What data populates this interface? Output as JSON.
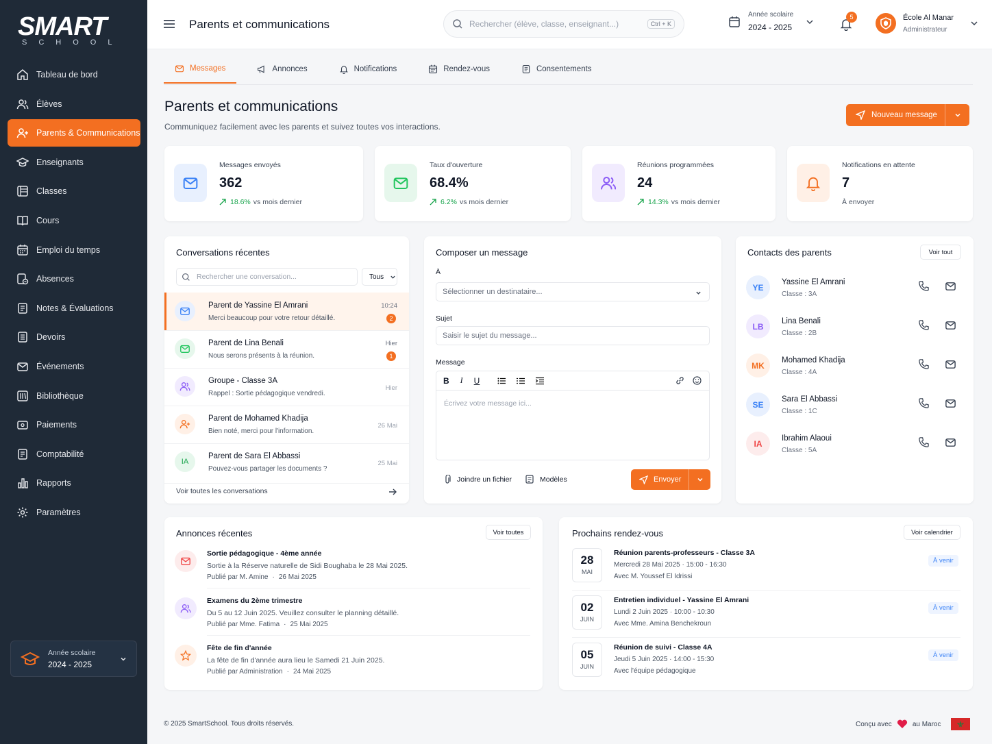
{
  "brand": {
    "name": "SMART",
    "sub": "SCHOOL"
  },
  "sidebar": {
    "items": [
      {
        "label": "Tableau de bord",
        "icon": "home-icon"
      },
      {
        "label": "Élèves",
        "icon": "users-icon"
      },
      {
        "label": "Parents & Communications",
        "icon": "user-group-icon"
      },
      {
        "label": "Enseignants",
        "icon": "graduation-cap-icon"
      },
      {
        "label": "Classes",
        "icon": "classes-icon"
      },
      {
        "label": "Cours",
        "icon": "book-icon"
      },
      {
        "label": "Emploi du temps",
        "icon": "calendar-icon"
      },
      {
        "label": "Absences",
        "icon": "absence-icon"
      },
      {
        "label": "Notes & Évaluations",
        "icon": "notes-icon"
      },
      {
        "label": "Devoirs",
        "icon": "homework-icon"
      },
      {
        "label": "Événements",
        "icon": "mail-icon"
      },
      {
        "label": "Bibliothèque",
        "icon": "library-icon"
      },
      {
        "label": "Paiements",
        "icon": "payment-icon"
      },
      {
        "label": "Comptabilité",
        "icon": "accounting-icon"
      },
      {
        "label": "Rapports",
        "icon": "chart-icon"
      },
      {
        "label": "Paramètres",
        "icon": "gear-icon"
      }
    ],
    "active_index": 2,
    "year_box": {
      "label": "Année scolaire",
      "value": "2024 - 2025"
    }
  },
  "topbar": {
    "title": "Parents et communications",
    "search_placeholder": "Rechercher (élève, classe, enseignant...)",
    "shortcut": "Ctrl + K",
    "year_label": "Année scolaire",
    "year_value": "2024 - 2025",
    "notif_count": "5",
    "school_name": "École Al Manar",
    "role": "Administrateur"
  },
  "tabs": [
    {
      "label": "Messages",
      "icon": "mail-icon"
    },
    {
      "label": "Annonces",
      "icon": "megaphone-icon"
    },
    {
      "label": "Notifications",
      "icon": "bell-icon"
    },
    {
      "label": "Rendez-vous",
      "icon": "calendar-icon"
    },
    {
      "label": "Consentements",
      "icon": "document-icon"
    }
  ],
  "page": {
    "title": "Parents et communications",
    "subtitle": "Communiquez facilement avec les parents et suivez toutes vos interactions.",
    "new_message": "Nouveau message"
  },
  "stats": [
    {
      "label": "Messages envoyés",
      "value": "362",
      "change": "18.6%",
      "vs": "vs mois dernier",
      "color": "#3b82f6"
    },
    {
      "label": "Taux d'ouverture",
      "value": "68.4%",
      "change": "6.2%",
      "vs": "vs mois dernier",
      "color": "#22c55e"
    },
    {
      "label": "Réunions programmées",
      "value": "24",
      "change": "14.3%",
      "vs": "vs mois dernier",
      "color": "#8b5cf6"
    },
    {
      "label": "Notifications en attente",
      "value": "7",
      "change": "",
      "vs": "À envoyer",
      "color": "#f36f21"
    }
  ],
  "conversations": {
    "title": "Conversations récentes",
    "search_placeholder": "Rechercher une conversation...",
    "filter": "Tous",
    "items": [
      {
        "name": "Parent de Yassine El Amrani",
        "message": "Merci beaucoup pour votre retour détaillé.",
        "time": "10:24",
        "unread": "2"
      },
      {
        "name": "Parent de Lina Benali",
        "message": "Nous serons présents à la réunion.",
        "time": "Hier",
        "unread": "1"
      },
      {
        "name": "Groupe - Classe 3A",
        "message": "Rappel : Sortie pédagogique vendredi.",
        "time": "Hier",
        "unread": ""
      },
      {
        "name": "Parent de Mohamed Khadija",
        "message": "Bien noté, merci pour l'information.",
        "time": "26 Mai",
        "unread": ""
      },
      {
        "name": "Parent de Sara El Abbassi",
        "message": "Pouvez-vous partager les documents ?",
        "time": "25 Mai",
        "unread": "",
        "initials": "IA"
      }
    ],
    "see_all": "Voir toutes les conversations"
  },
  "compose": {
    "title": "Composer un message",
    "to_label": "À",
    "to_placeholder": "Sélectionner un destinataire...",
    "subject_label": "Sujet",
    "subject_placeholder": "Saisir le sujet du message...",
    "message_label": "Message",
    "message_placeholder": "Écrivez votre message ici...",
    "attach": "Joindre un fichier",
    "templates": "Modèles",
    "send": "Envoyer"
  },
  "contacts": {
    "title": "Contacts des parents",
    "see_all": "Voir tout",
    "items": [
      {
        "initials": "YE",
        "name": "Yassine El Amrani",
        "class": "Classe : 3A",
        "color": "#3b82f6",
        "bg": "#e8f0fe"
      },
      {
        "initials": "LB",
        "name": "Lina Benali",
        "class": "Classe : 2B",
        "color": "#8b5cf6",
        "bg": "#f1ebfe"
      },
      {
        "initials": "MK",
        "name": "Mohamed Khadija",
        "class": "Classe : 4A",
        "color": "#f36f21",
        "bg": "#fff0e6"
      },
      {
        "initials": "SE",
        "name": "Sara El Abbassi",
        "class": "Classe : 1C",
        "color": "#3b82f6",
        "bg": "#e8f0fe"
      },
      {
        "initials": "IA",
        "name": "Ibrahim Alaoui",
        "class": "Classe : 5A",
        "color": "#ef4444",
        "bg": "#fdecec"
      }
    ]
  },
  "announcements": {
    "title": "Annonces récentes",
    "see_all": "Voir toutes",
    "items": [
      {
        "title": "Sortie pédagogique - 4ème année",
        "desc": "Sortie à la Réserve naturelle de Sidi Boughaba le 28 Mai 2025.",
        "author": "Publié par M. Amine",
        "date": "26 Mai 2025"
      },
      {
        "title": "Examens du 2ème trimestre",
        "desc": "Du 5 au 12 Juin 2025. Veuillez consulter le planning détaillé.",
        "author": "Publié par Mme. Fatima",
        "date": "25 Mai 2025"
      },
      {
        "title": "Fête de fin d'année",
        "desc": "La fête de fin d'année aura lieu le Samedi 21 Juin 2025.",
        "author": "Publié par Administration",
        "date": "24 Mai 2025"
      }
    ]
  },
  "appointments": {
    "title": "Prochains rendez-vous",
    "see_all": "Voir calendrier",
    "items": [
      {
        "day": "28",
        "month": "MAI",
        "title": "Réunion parents-professeurs - Classe 3A",
        "when": "Mercredi 28 Mai 2025 · 15:00 - 16:30",
        "with": "Avec M. Youssef El Idrissi",
        "status": "À venir"
      },
      {
        "day": "02",
        "month": "JUIN",
        "title": "Entretien individuel - Yassine El Amrani",
        "when": "Lundi 2 Juin 2025 · 10:00 - 10:30",
        "with": "Avec Mme. Amina Benchekroun",
        "status": "À venir"
      },
      {
        "day": "05",
        "month": "JUIN",
        "title": "Réunion de suivi - Classe 4A",
        "when": "Jeudi 5 Juin 2025 · 14:00 - 15:30",
        "with": "Avec l'équipe pédagogique",
        "status": "À venir"
      }
    ]
  },
  "footer": {
    "copyright": "© 2025 SmartSchool. Tous droits réservés.",
    "made_with": "Conçu avec",
    "made_in": "au Maroc"
  }
}
